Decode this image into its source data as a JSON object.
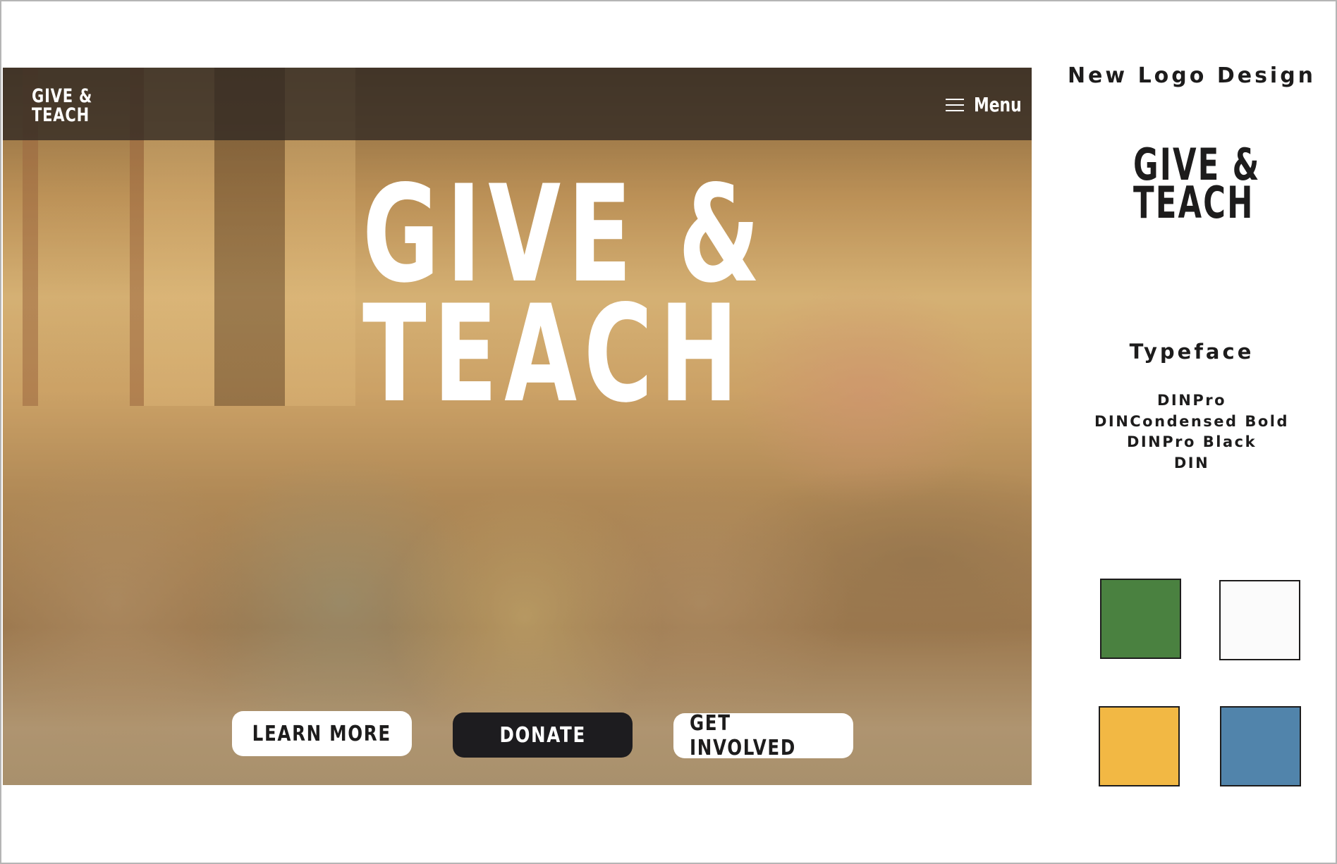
{
  "hero": {
    "nav": {
      "logo_line1": "GIVE &",
      "logo_line2": "TEACH",
      "menu_label": "Menu",
      "menu_icon": "hamburger-icon"
    },
    "title_line1": "GIVE &",
    "title_line2": "TEACH",
    "buttons": {
      "learn_more": "LEARN MORE",
      "donate": "DONATE",
      "get_involved": "GET INVOLVED"
    }
  },
  "sidebar": {
    "logo_design_title": "New Logo Design",
    "logo_line1": "GIVE &",
    "logo_line2": "TEACH",
    "typeface_title": "Typeface",
    "typefaces": [
      "DINPro",
      "DINCondensed Bold",
      "DINPro Black",
      "DIN"
    ],
    "palette": {
      "green": "#4a8140",
      "white": "#fbfbfb",
      "yellow": "#f2b844",
      "blue": "#5184ab"
    }
  }
}
